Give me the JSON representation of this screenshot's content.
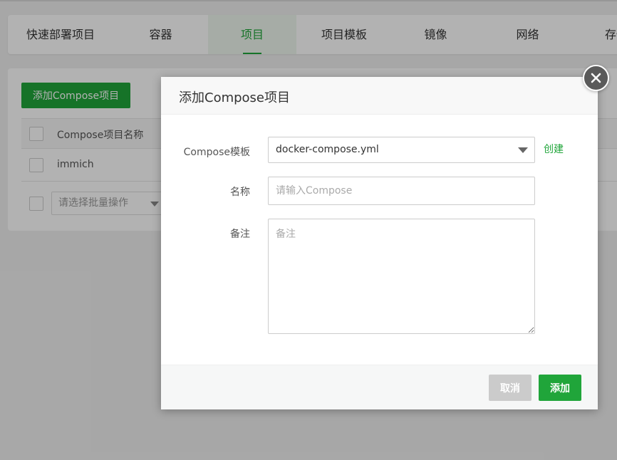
{
  "tabs": [
    {
      "label": "快速部署项目"
    },
    {
      "label": "容器"
    },
    {
      "label": "项目"
    },
    {
      "label": "项目模板"
    },
    {
      "label": "镜像"
    },
    {
      "label": "网络"
    },
    {
      "label": "存储"
    }
  ],
  "active_tab": "项目",
  "panel": {
    "add_button_label": "添加Compose项目",
    "table": {
      "header_name": "Compose项目名称",
      "rows": [
        {
          "name": "immich"
        }
      ]
    },
    "batch_placeholder": "请选择批量操作"
  },
  "dialog": {
    "title": "添加Compose项目",
    "template_label": "Compose模板",
    "template_value": "docker-compose.yml",
    "create_link": "创建",
    "name_label": "名称",
    "name_placeholder": "请输入Compose",
    "remark_label": "备注",
    "remark_placeholder": "备注",
    "cancel_label": "取消",
    "add_label": "添加"
  },
  "colors": {
    "accent": "#20a53a",
    "cancel_bg": "#cbcbcb",
    "close_bg": "#5a5a5a"
  },
  "icons": {
    "close": "close-icon",
    "dropdown": "chevron-down-icon"
  }
}
